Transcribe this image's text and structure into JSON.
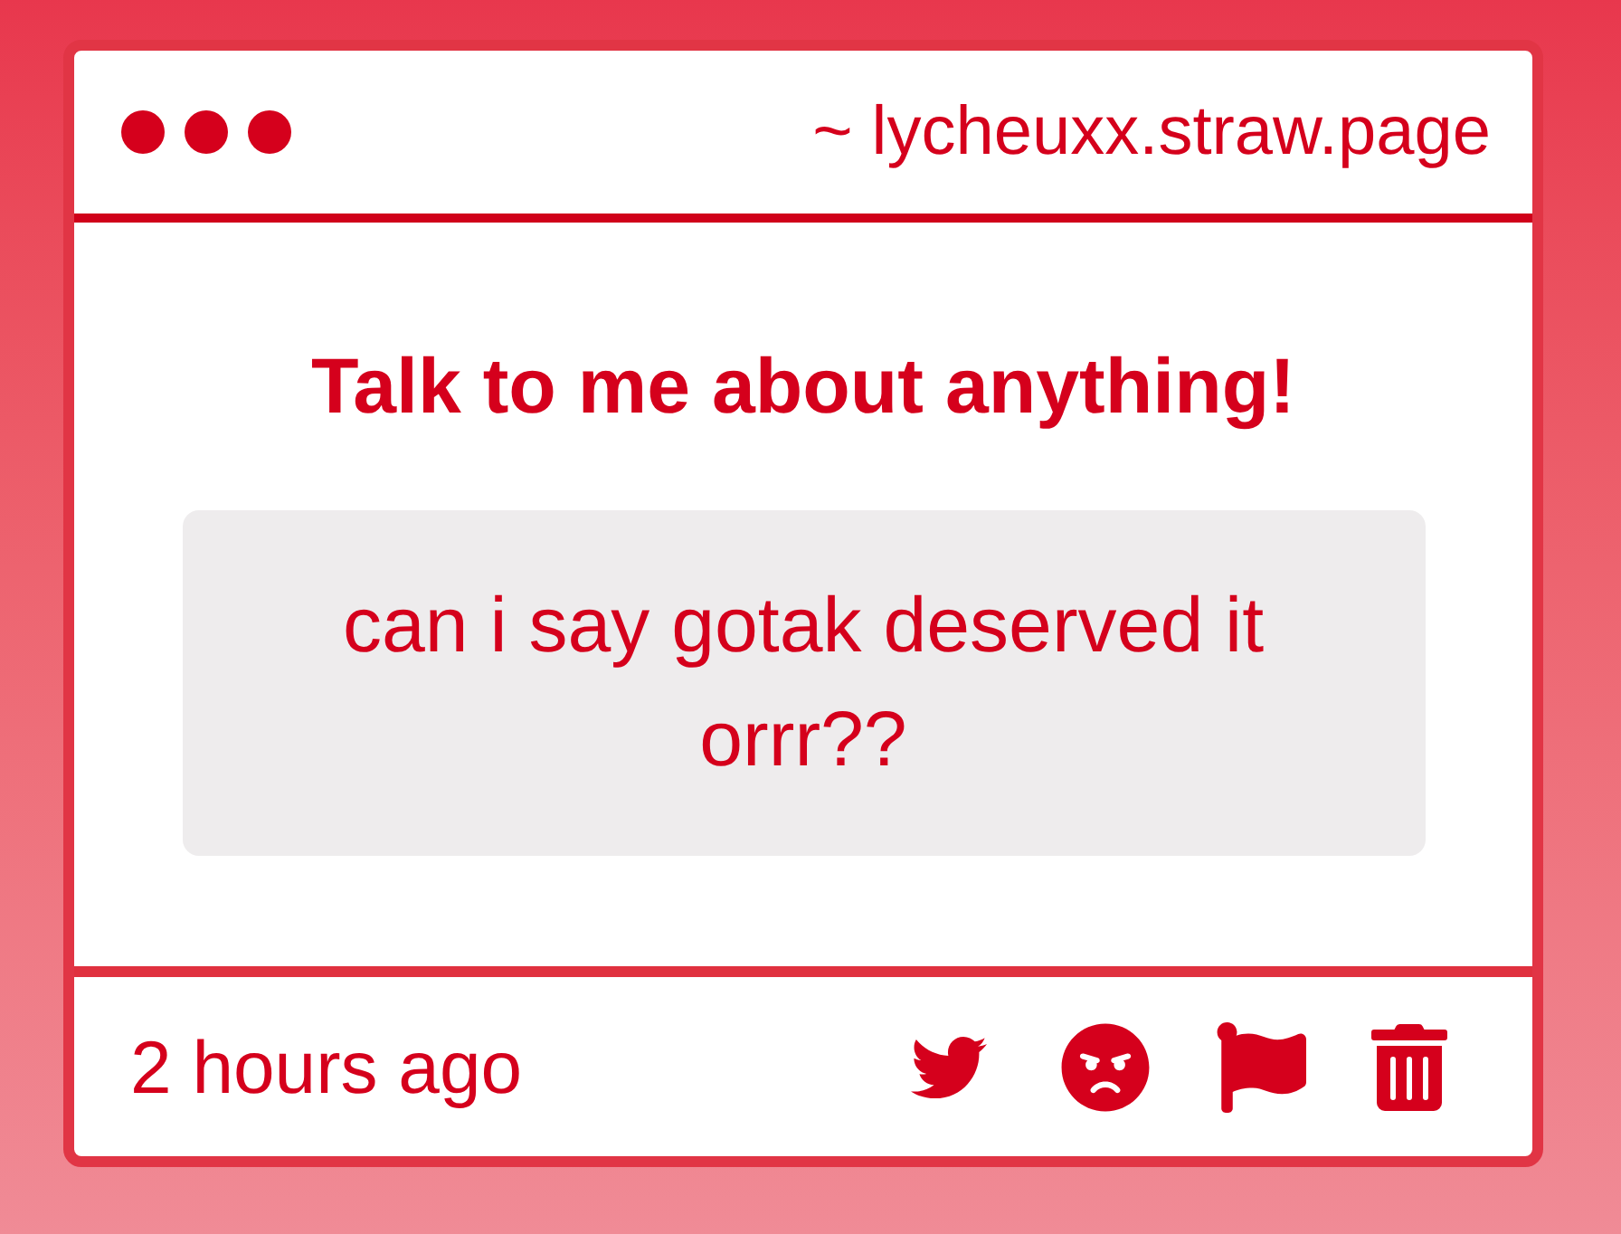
{
  "window": {
    "url": "~ lycheuxx.straw.page"
  },
  "prompt": "Talk to me about anything!",
  "message": "can i say gotak deserved it orrr??",
  "footer": {
    "time": "2 hours ago"
  }
}
